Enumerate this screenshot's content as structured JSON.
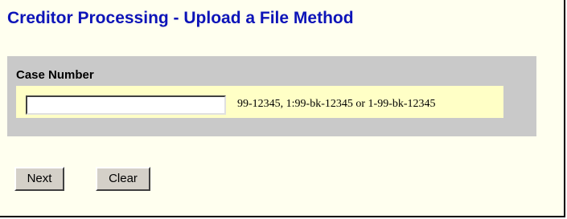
{
  "page": {
    "title": "Creditor Processing - Upload a File Method"
  },
  "case_section": {
    "label": "Case Number",
    "input_value": "",
    "format_hint": "99-12345, 1:99-bk-12345 or 1-99-bk-12345"
  },
  "buttons": {
    "next_label": "Next",
    "clear_label": "Clear"
  },
  "colors": {
    "title": "#0d14b8",
    "background": "#ffffef",
    "panel": "#c9c9c9",
    "input_row": "#ffffc6"
  }
}
